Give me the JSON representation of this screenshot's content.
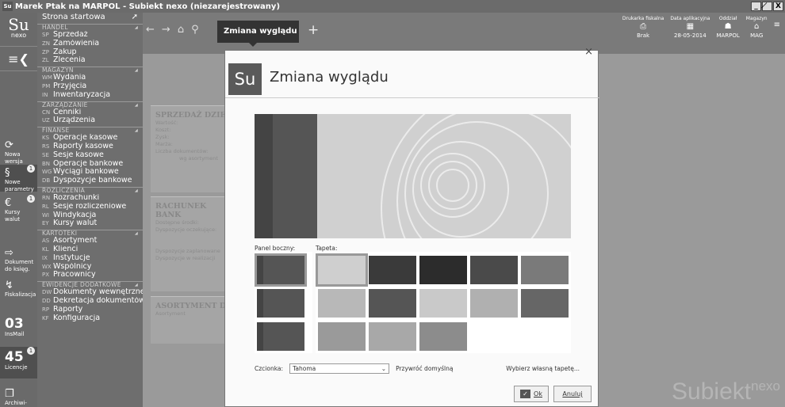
{
  "window": {
    "title": "Marek Ptak na MARPOL - Subiekt nexo (niezarejestrowany)",
    "app_icon": "Su",
    "controls": [
      "_",
      "̸",
      "X"
    ]
  },
  "logo": {
    "su": "Su",
    "nexo": "nexo"
  },
  "leftbar": [
    {
      "label1": "Nowa",
      "label2": "wersja",
      "icon": "⟳"
    },
    {
      "label1": "Nowe",
      "label2": "parametry",
      "icon": "§",
      "badge": "1"
    },
    {
      "label1": "Kursy",
      "label2": "walut",
      "icon": "€",
      "badge": "1"
    },
    {
      "label1": "Dokument",
      "label2": "do księg.",
      "icon": "⇨"
    },
    {
      "label1": "Fiskalizacja",
      "label2": "",
      "icon": "↯"
    },
    {
      "big": "03",
      "label1": "InsMail"
    },
    {
      "big": "45",
      "label1": "Licencje",
      "badge": "1"
    },
    {
      "label1": "Archiwi-",
      "icon": "❐"
    }
  ],
  "menu": {
    "start": "Strona startowa",
    "sections": [
      {
        "title": "HANDEL",
        "items": [
          [
            "SP",
            "Sprzedaż"
          ],
          [
            "ZN",
            "Zamówienia"
          ],
          [
            "ZP",
            "Zakup"
          ],
          [
            "ZL",
            "Zlecenia"
          ]
        ]
      },
      {
        "title": "MAGAZYN",
        "items": [
          [
            "WM",
            "Wydania"
          ],
          [
            "PM",
            "Przyjęcia"
          ],
          [
            "IN",
            "Inwentaryzacja"
          ]
        ]
      },
      {
        "title": "ZARZĄDZANIE",
        "items": [
          [
            "CN",
            "Cenniki"
          ],
          [
            "UZ",
            "Urządzenia"
          ]
        ]
      },
      {
        "title": "FINANSE",
        "items": [
          [
            "KS",
            "Operacje kasowe"
          ],
          [
            "RS",
            "Raporty kasowe"
          ],
          [
            "SE",
            "Sesje kasowe"
          ],
          [
            "BN",
            "Operacje bankowe"
          ],
          [
            "WG",
            "Wyciągi bankowe"
          ],
          [
            "DB",
            "Dyspozycje bankowe"
          ]
        ]
      },
      {
        "title": "ROZLICZENIA",
        "items": [
          [
            "RN",
            "Rozrachunki"
          ],
          [
            "RL",
            "Sesje rozliczeniowe"
          ],
          [
            "WI",
            "Windykacja"
          ],
          [
            "EY",
            "Kursy walut"
          ]
        ]
      },
      {
        "title": "KARTOTEKI",
        "items": [
          [
            "AS",
            "Asortyment"
          ],
          [
            "KL",
            "Klienci"
          ],
          [
            "IX",
            "Instytucje"
          ],
          [
            "WX",
            "Wspólnicy"
          ],
          [
            "PX",
            "Pracownicy"
          ]
        ]
      },
      {
        "title": "EWIDENCJE DODATKOWE",
        "items": [
          [
            "DW",
            "Dokumenty wewnętrzne"
          ],
          [
            "DD",
            "Dekretacja dokumentów"
          ],
          [
            "RP",
            "Raporty"
          ],
          [
            "KF",
            "Konfiguracja"
          ]
        ]
      }
    ]
  },
  "topnav": {
    "tab": "Zmiana wyglądu",
    "plus": "+",
    "info": [
      {
        "label": "Drukarka fiskalna",
        "value": "Brak",
        "icon": "⎙"
      },
      {
        "label": "Data aplikacyjna",
        "value": "28-05-2014",
        "icon": "▦"
      },
      {
        "label": "Oddział",
        "value": "MARPOL",
        "icon": "☗"
      },
      {
        "label": "Magazyn",
        "value": "MAG",
        "icon": "⌂"
      }
    ]
  },
  "widgets": [
    {
      "title": "SPRZEDAŻ DZIE",
      "lines": [
        "Wartość:",
        "Koszt:",
        "Zysk:",
        "Marża:",
        "Liczba dokumentów:",
        "wg asortyment"
      ]
    },
    {
      "title": "RACHUNEK BANK",
      "lines": [
        "Dostępne środki:",
        "Dyspozycje oczekujące:",
        "",
        "Dyspozycje zaplanowane",
        "Dyspozycje w realizacji"
      ]
    },
    {
      "title": "ASORTYMENT DO",
      "lines": [
        "Asortyment"
      ]
    }
  ],
  "watermark": {
    "main": "Subiekt",
    "sup": "nexo"
  },
  "dialog": {
    "close": "×",
    "logo": "Su",
    "title": "Zmiana wyglądu",
    "panel_label": "Panel boczny:",
    "wallpaper_label": "Tapeta:",
    "font_label": "Czcionka:",
    "font_value": "Tahoma",
    "restore": "Przywróć domyślną",
    "own_wallpaper": "Wybierz własną tapetę...",
    "ok": "Ok",
    "cancel": "Anuluj"
  }
}
